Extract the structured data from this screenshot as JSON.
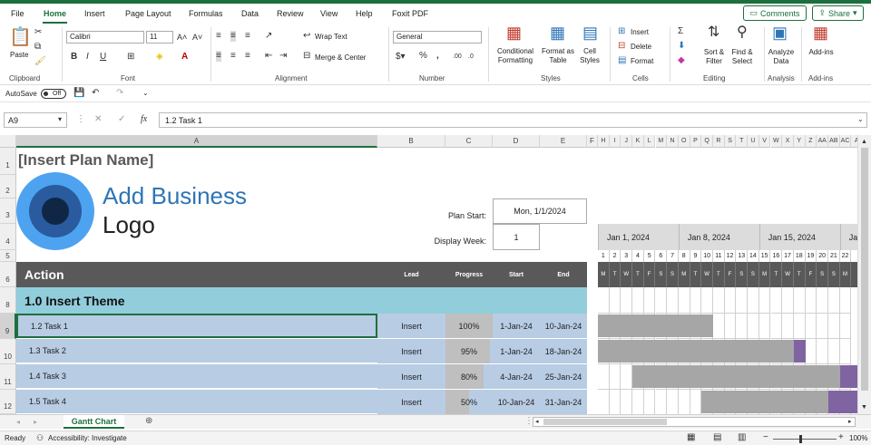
{
  "menu": {
    "items": [
      "File",
      "Home",
      "Insert",
      "Page Layout",
      "Formulas",
      "Data",
      "Review",
      "View",
      "Help",
      "Foxit PDF"
    ],
    "active": "Home",
    "comments_label": "Comments",
    "share_label": "Share"
  },
  "ribbon": {
    "paste_label": "Paste",
    "font_name": "Calibri",
    "font_size": "11",
    "wrap_text_label": "Wrap Text",
    "merge_center_label": "Merge & Center",
    "number_format": "General",
    "conditional_formatting_label": "Conditional Formatting",
    "format_as_table_label": "Format as Table",
    "cell_styles_label": "Cell Styles",
    "insert_label": "Insert",
    "delete_label": "Delete",
    "format_label": "Format",
    "sort_filter_label": "Sort & Filter",
    "find_select_label": "Find & Select",
    "analyze_data_label": "Analyze Data",
    "addins_label": "Add-ins",
    "groups": {
      "clipboard": "Clipboard",
      "font": "Font",
      "alignment": "Alignment",
      "number": "Number",
      "styles": "Styles",
      "cells": "Cells",
      "editing": "Editing",
      "analysis": "Analysis",
      "addins": "Add-ins"
    }
  },
  "qat": {
    "autosave_label": "AutoSave",
    "autosave_state": "Off"
  },
  "formula_bar": {
    "name_box": "A9",
    "fx": "fx",
    "content": "1.2 Task 1"
  },
  "columns": [
    "A",
    "B",
    "C",
    "D",
    "E",
    "F",
    "H",
    "I",
    "J",
    "K",
    "L",
    "M",
    "N",
    "O",
    "P",
    "Q",
    "R",
    "S",
    "T",
    "U",
    "V",
    "W",
    "X",
    "Y",
    "Z",
    "AA",
    "AB",
    "AC",
    "A"
  ],
  "rows": [
    "1",
    "2",
    "3",
    "4",
    "5",
    "6",
    "8",
    "9",
    "10",
    "11",
    "12"
  ],
  "sheet": {
    "plan_name": "[Insert Plan Name]",
    "logo_line1": "Add Business",
    "logo_line2": "Logo",
    "plan_start_label": "Plan Start:",
    "plan_start_value": "Mon, 1/1/2024",
    "display_week_label": "Display Week:",
    "display_week_value": "1",
    "header": {
      "action": "Action",
      "lead": "Lead",
      "progress": "Progress",
      "start": "Start",
      "end": "End"
    },
    "theme": "1.0 Insert Theme",
    "tasks": [
      {
        "name": "1.2 Task 1",
        "lead": "Insert",
        "progress": "100%",
        "start": "1-Jan-24",
        "end": "10-Jan-24"
      },
      {
        "name": "1.3 Task 2",
        "lead": "Insert",
        "progress": "95%",
        "start": "1-Jan-24",
        "end": "18-Jan-24"
      },
      {
        "name": "1.4 Task 3",
        "lead": "Insert",
        "progress": "80%",
        "start": "4-Jan-24",
        "end": "25-Jan-24"
      },
      {
        "name": "1.5 Task 4",
        "lead": "Insert",
        "progress": "50%",
        "start": "10-Jan-24",
        "end": "31-Jan-24"
      }
    ],
    "weeks": [
      "Jan 1, 2024",
      "Jan 8, 2024",
      "Jan 15, 2024",
      "Jan"
    ],
    "day_numbers": [
      "1",
      "2",
      "3",
      "4",
      "5",
      "6",
      "7",
      "8",
      "9",
      "10",
      "11",
      "12",
      "13",
      "14",
      "15",
      "16",
      "17",
      "18",
      "19",
      "20",
      "21",
      "22"
    ],
    "day_letters": [
      "M",
      "T",
      "W",
      "T",
      "F",
      "S",
      "S",
      "M",
      "T",
      "W",
      "T",
      "F",
      "S",
      "S",
      "M",
      "T",
      "W",
      "T",
      "F",
      "S",
      "S",
      "M"
    ]
  },
  "colors": {
    "dark_header": "#595959",
    "theme_row": "#92cddc",
    "task_row": "#b8cce4",
    "bar_done": "#a6a6a6",
    "bar_todo": "#8064a2",
    "logo_blue": "#2e75b6"
  },
  "tabs": {
    "active": "Gantt Chart"
  },
  "status": {
    "ready": "Ready",
    "accessibility": "Accessibility: Investigate",
    "zoom": "100%"
  }
}
